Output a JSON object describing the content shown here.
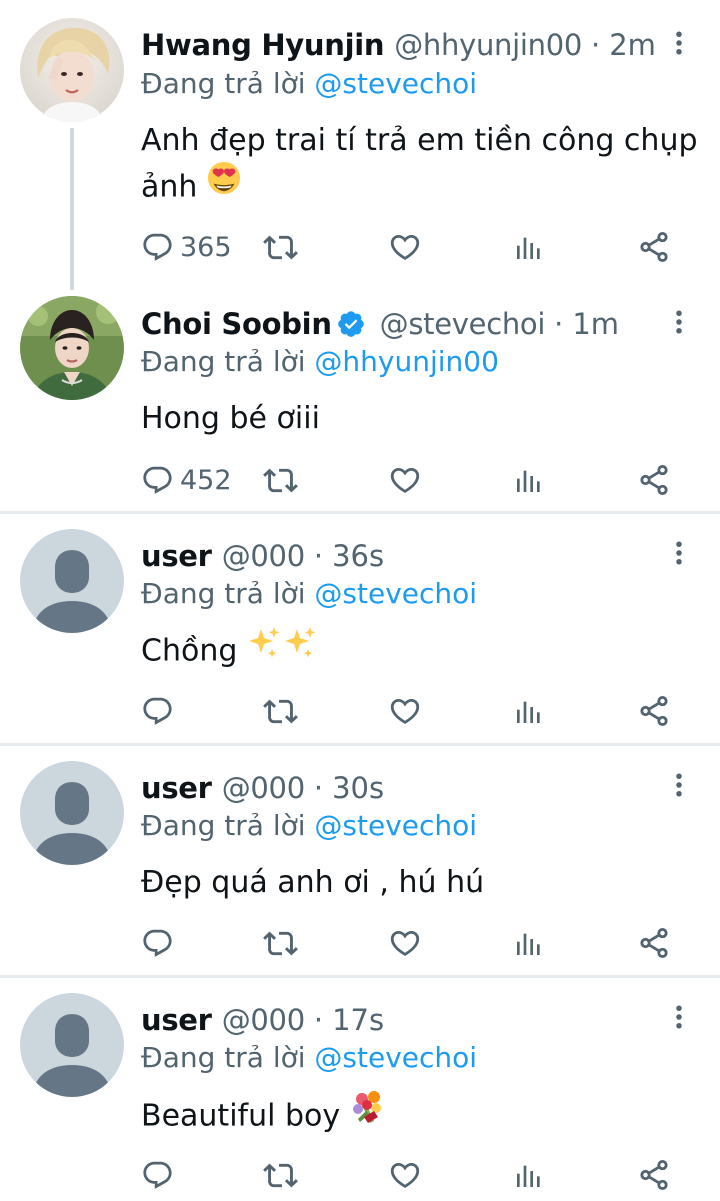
{
  "reply_prefix": "Đang trả lời",
  "colors": {
    "link": "#1d9bf0",
    "secondary_text": "#536471",
    "primary_text": "#0f1419",
    "default_avatar_bg": "#ccd6dd",
    "default_avatar_fg": "#657786"
  },
  "tweets": [
    {
      "name": "Hwang Hyunjin",
      "handle": "@hhyunjin00",
      "dot": "·",
      "time": "2m",
      "verified": false,
      "avatar": "photo-avatar-blond",
      "reply_to": "@stevechoi",
      "text_line1": "Anh đẹp trai tí trả em tiền công chụp",
      "text_line2": "ảnh",
      "emoji": "smiling-face-with-heart-eyes",
      "reply_count": "365"
    },
    {
      "name": "Choi Soobin",
      "handle": "@stevechoi",
      "dot": "·",
      "time": "1m",
      "verified": true,
      "avatar": "photo-avatar-green-jacket",
      "reply_to": "@hhyunjin00",
      "text": "Hong bé ơiii",
      "reply_count": "452"
    },
    {
      "name": "user",
      "handle": "@000",
      "dot": "·",
      "time": "36s",
      "verified": false,
      "avatar": "default-avatar",
      "reply_to": "@stevechoi",
      "text": "Chồng",
      "emoji": "sparkles",
      "reply_count": ""
    },
    {
      "name": "user",
      "handle": "@000",
      "dot": "·",
      "time": "30s",
      "verified": false,
      "avatar": "default-avatar",
      "reply_to": "@stevechoi",
      "text": "Đẹp quá anh ơi , hú hú",
      "reply_count": ""
    },
    {
      "name": "user",
      "handle": "@000",
      "dot": "·",
      "time": "17s",
      "verified": false,
      "avatar": "default-avatar",
      "reply_to": "@stevechoi",
      "text": "Beautiful boy",
      "emoji": "bouquet",
      "reply_count": ""
    }
  ]
}
